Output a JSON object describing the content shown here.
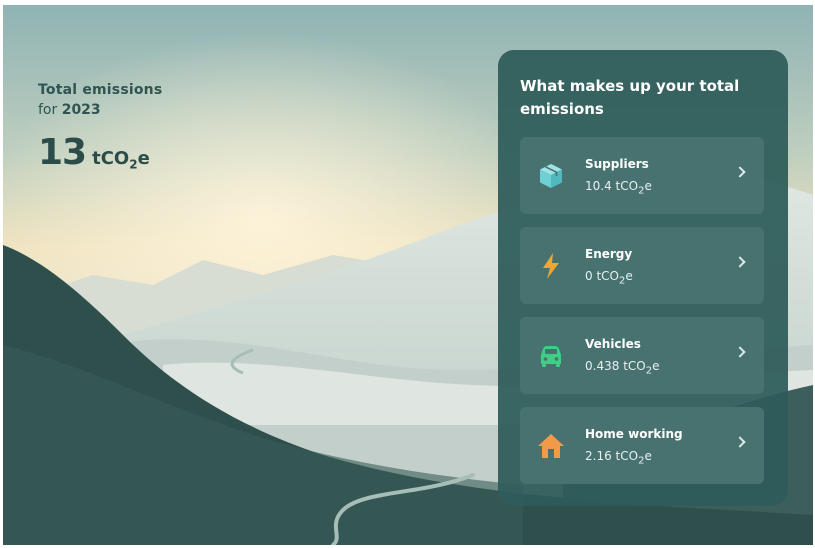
{
  "summary": {
    "label_line1": "Total emissions",
    "label_for": "for",
    "year": "2023",
    "total_value": "13",
    "unit_prefix": "tCO",
    "unit_sub": "2",
    "unit_suffix": "e"
  },
  "breakdown": {
    "title": "What makes up your total emissions",
    "categories": [
      {
        "name": "Suppliers",
        "value": "10.4",
        "icon": "box-icon",
        "icon_color": "#6fd0d3"
      },
      {
        "name": "Energy",
        "value": "0",
        "icon": "lightning-icon",
        "icon_color": "#f2a531"
      },
      {
        "name": "Vehicles",
        "value": "0.438",
        "icon": "car-icon",
        "icon_color": "#3ecf85"
      },
      {
        "name": "Home working",
        "value": "2.16",
        "icon": "house-icon",
        "icon_color": "#f39a4a"
      }
    ]
  },
  "colors": {
    "panel": "#2f5c5a",
    "card": "#47726f",
    "heading": "#2f5451"
  }
}
